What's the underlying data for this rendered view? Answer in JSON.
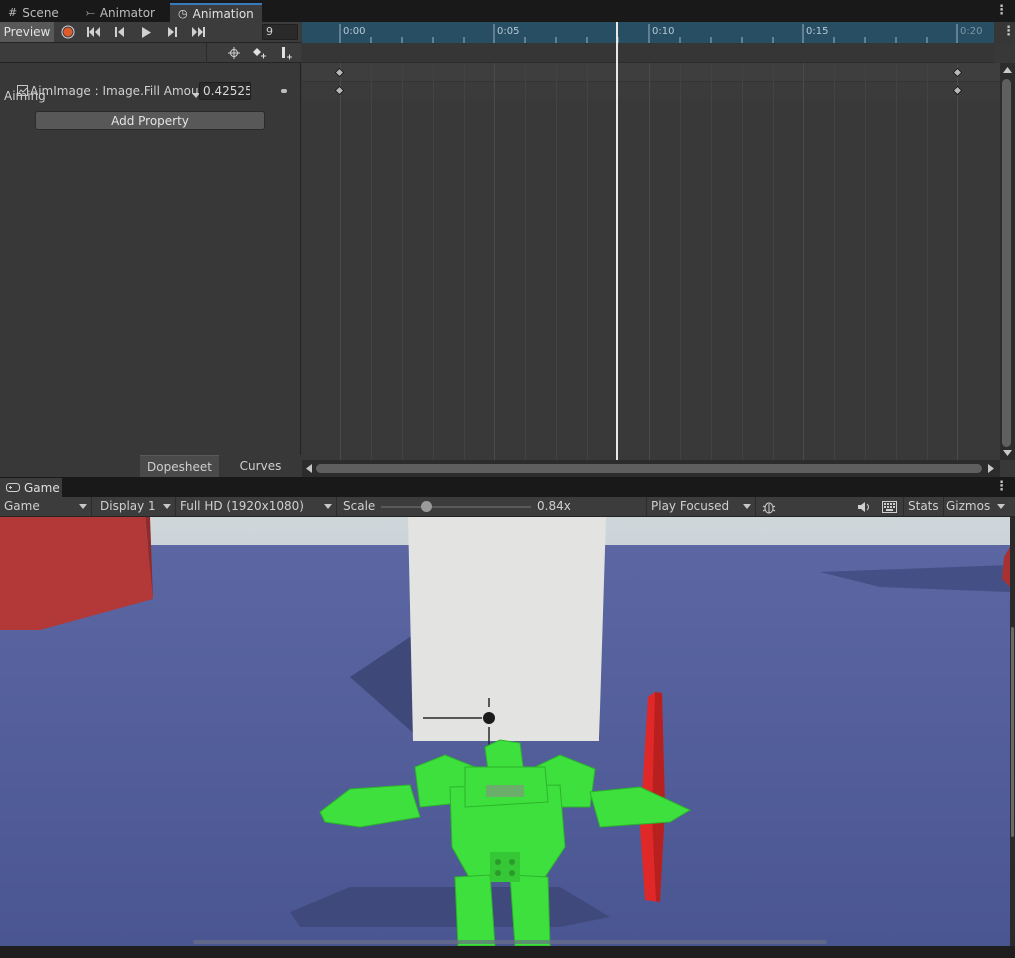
{
  "tabs": [
    {
      "label": "Scene",
      "icon": "grid-icon"
    },
    {
      "label": "Animator",
      "icon": "animator-icon"
    },
    {
      "label": "Animation",
      "icon": "clock-icon",
      "active": true
    }
  ],
  "animation": {
    "preview_label": "Preview",
    "frame_value": "9",
    "clip_name": "Aiming",
    "property_label": "AimImage : Image.Fill Amount",
    "property_value": "0.42525",
    "add_property_label": "Add Property",
    "bottom_tabs": [
      "Dopesheet",
      "Curves"
    ],
    "ruler_labels": [
      "0:00",
      "0:05",
      "0:10",
      "0:15",
      "0:20"
    ],
    "colors": {
      "record": "#e05b2b",
      "ruler": "#274e63"
    }
  },
  "game": {
    "tab_label": "Game",
    "view_select": "Game",
    "display_select": "Display 1",
    "resolution_select": "Full HD (1920x1080)",
    "scale_label": "Scale",
    "scale_value_text": "0.84x",
    "play_mode_select": "Play Focused",
    "stats_label": "Stats",
    "gizmos_label": "Gizmos",
    "colors": {
      "robot": "#3ee03e",
      "red_object": "#c93a3a",
      "ground": "#4a5790"
    }
  }
}
